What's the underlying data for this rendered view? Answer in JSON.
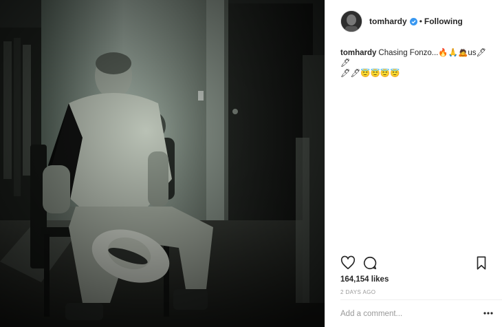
{
  "post": {
    "username": "tomhardy",
    "verified": true,
    "separator": "•",
    "follow_status": "Following",
    "caption": {
      "user": "tomhardy",
      "text": "Chasing Fonzo...",
      "emoji_line1": "🔥🙏🙇",
      "us_text": "us",
      "emoji_line1_end": "🖊🖊",
      "emoji_line2": "🖊🖊😇😇😇😇"
    },
    "likes_text": "164,154 likes",
    "date_text": "2 DAYS AGO",
    "comment_placeholder": "Add a comment...",
    "photo_description_icon": "photo",
    "icons": {
      "like": "heart-icon",
      "comment": "comment-icon",
      "save": "bookmark-icon",
      "more": "more-options-icon",
      "verified": "verified-badge-icon"
    },
    "colors": {
      "text": "#262626",
      "muted": "#999999",
      "verified_blue": "#3897f0"
    }
  }
}
